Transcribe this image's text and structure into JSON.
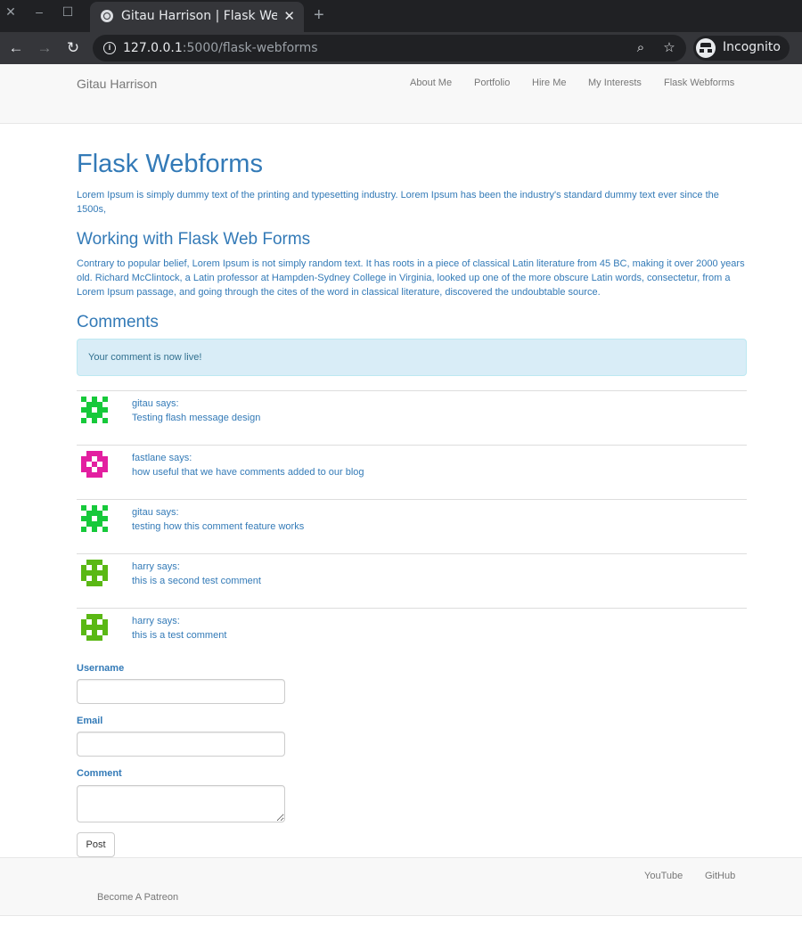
{
  "browser": {
    "tab_title": "Gitau Harrison | Flask Webforms",
    "url_host": "127.0.0.1",
    "url_rest": ":5000/flask-webforms",
    "incognito_label": "Incognito"
  },
  "navbar": {
    "brand": "Gitau Harrison",
    "links": [
      "About Me",
      "Portfolio",
      "Hire Me",
      "My Interests",
      "Flask Webforms"
    ]
  },
  "main": {
    "title": "Flask Webforms",
    "intro": "Lorem Ipsum is simply dummy text of the printing and typesetting industry. Lorem Ipsum has been the industry's standard dummy text ever since the 1500s,",
    "section_title": "Working with Flask Web Forms",
    "section_text": "Contrary to popular belief, Lorem Ipsum is not simply random text. It has roots in a piece of classical Latin literature from 45 BC, making it over 2000 years old. Richard McClintock, a Latin professor at Hampden-Sydney College in Virginia, looked up one of the more obscure Latin words, consectetur, from a Lorem Ipsum passage, and going through the cites of the word in classical literature, discovered the undoubtable source.",
    "comments_title": "Comments",
    "alert": "Your comment is now live!"
  },
  "comments": [
    {
      "author": "gitau says:",
      "body": "Testing flash message design",
      "avatar_color": "#16c93a"
    },
    {
      "author": "fastlane says:",
      "body": "how useful that we have comments added to our blog",
      "avatar_color": "#e31fa0"
    },
    {
      "author": "gitau says:",
      "body": "testing how this comment feature works",
      "avatar_color": "#16c93a"
    },
    {
      "author": "harry says:",
      "body": "this is a second test comment",
      "avatar_color": "#5ab814"
    },
    {
      "author": "harry says:",
      "body": "this is a test comment",
      "avatar_color": "#5ab814"
    }
  ],
  "form": {
    "username_label": "Username",
    "email_label": "Email",
    "comment_label": "Comment",
    "submit_label": "Post"
  },
  "footer": {
    "youtube": "YouTube",
    "github": "GitHub",
    "patreon": "Become A Patreon"
  }
}
